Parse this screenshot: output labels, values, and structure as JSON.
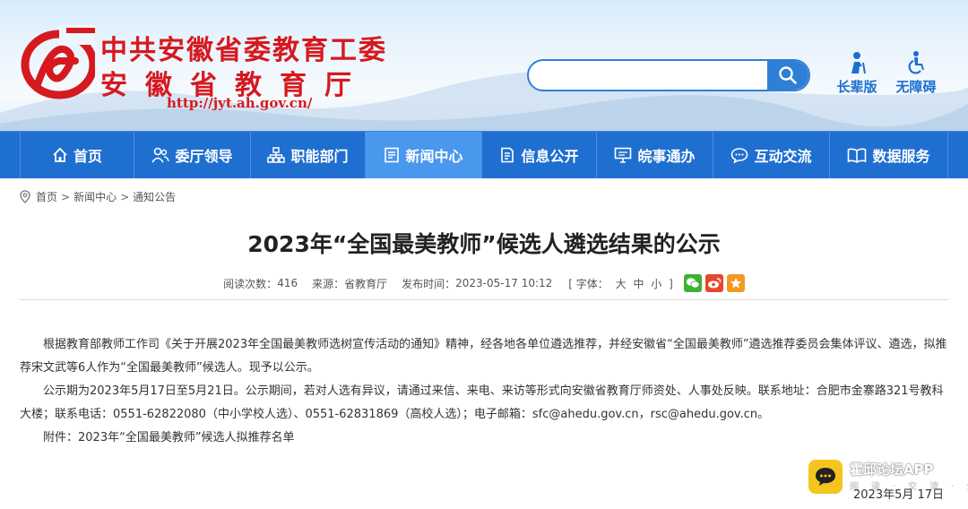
{
  "header": {
    "org_name_line1": "中共安徽省委教育工委",
    "org_name_line2": "安徽省教育厅",
    "url": "http://jyt.ah.gov.cn/",
    "search": {
      "placeholder": "",
      "value": ""
    },
    "tools": [
      {
        "label": "长辈版",
        "icon": "elder-icon"
      },
      {
        "label": "无障碍",
        "icon": "accessibility-icon"
      }
    ]
  },
  "nav": {
    "items": [
      {
        "label": "首页",
        "icon": "home-icon"
      },
      {
        "label": "委厅领导",
        "icon": "leaders-icon"
      },
      {
        "label": "职能部门",
        "icon": "org-chart-icon"
      },
      {
        "label": "新闻中心",
        "icon": "news-icon",
        "active": true
      },
      {
        "label": "信息公开",
        "icon": "document-icon"
      },
      {
        "label": "皖事通办",
        "icon": "monitor-icon"
      },
      {
        "label": "互动交流",
        "icon": "chat-icon"
      },
      {
        "label": "数据服务",
        "icon": "book-icon"
      }
    ]
  },
  "breadcrumb": [
    "首页",
    "新闻中心",
    "通知公告"
  ],
  "breadcrumb_separator": ">",
  "article": {
    "title": "2023年“全国最美教师”候选人遴选结果的公示",
    "meta": {
      "reads_label": "阅读次数：",
      "reads": "416",
      "source_label": "来源：",
      "source": "省教育厅",
      "time_label": "发布时间：",
      "time": "2023-05-17 10:12",
      "font_open": "[ 字体：",
      "font_sizes": [
        "大",
        "中",
        "小"
      ],
      "font_close": "]"
    },
    "share": [
      {
        "icon": "wechat-icon",
        "color": "#3eb135"
      },
      {
        "icon": "weibo-icon",
        "color": "#e6462c"
      },
      {
        "icon": "star-icon",
        "color": "#f39a1e"
      }
    ],
    "paragraphs": [
      "根据教育部教师工作司《关于开展2023年全国最美教师选树宣传活动的通知》精神，经各地各单位遴选推荐，并经安徽省“全国最美教师”遴选推荐委员会集体评议、遴选，拟推荐宋文武等6人作为“全国最美教师”候选人。现予以公示。",
      "公示期为2023年5月17日至5月21日。公示期间，若对人选有异议，请通过来信、来电、来访等形式向安徽省教育厅师资处、人事处反映。联系地址：合肥市金寨路321号教科大楼；联系电话：0551-62822080（中小学校人选）、0551-62831869（高校人选）；电子邮箱：sfc@ahedu.gov.cn，rsc@ahedu.gov.cn。",
      "附件：2023年“全国最美教师”候选人拟推荐名单"
    ]
  },
  "watermark": {
    "name": "霍邱论坛APP",
    "sub": "阅读·交流·分享"
  },
  "footer_date": "2023年5月 17日",
  "colors": {
    "brand_red": "#d6191f",
    "nav_blue": "#1f6fd0",
    "nav_active": "#4a97ee"
  }
}
